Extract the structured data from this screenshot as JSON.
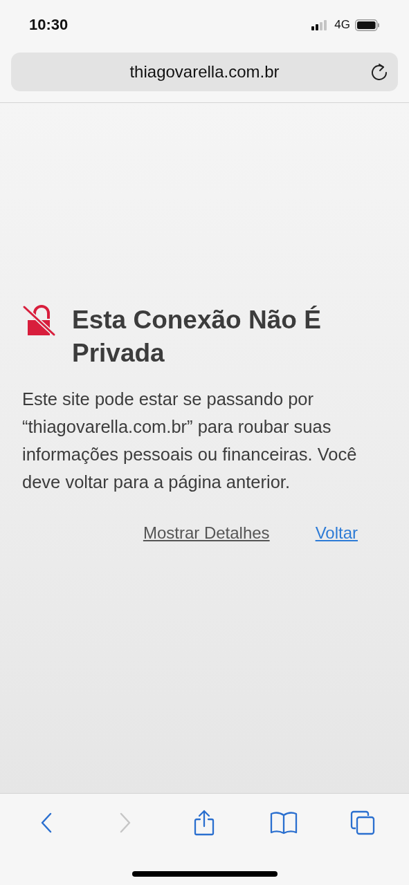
{
  "status_bar": {
    "time": "10:30",
    "network": "4G"
  },
  "address_bar": {
    "url": "thiagovarella.com.br"
  },
  "warning": {
    "title": "Esta Conexão Não É Privada",
    "message": "Este site pode estar se passando por “thiagovarella.com.br” para roubar suas informações pessoais ou financeiras. Você deve voltar para a página anterior.",
    "links": [
      {
        "label": "Mostrar Detalhes",
        "kind": "details"
      },
      {
        "label": "Voltar",
        "kind": "back"
      }
    ]
  },
  "toolbar": [
    {
      "kind": "back",
      "disabled": false
    },
    {
      "kind": "forward",
      "disabled": true
    },
    {
      "kind": "share",
      "disabled": false
    },
    {
      "kind": "bookmarks",
      "disabled": false
    },
    {
      "kind": "tabs",
      "disabled": false
    }
  ]
}
